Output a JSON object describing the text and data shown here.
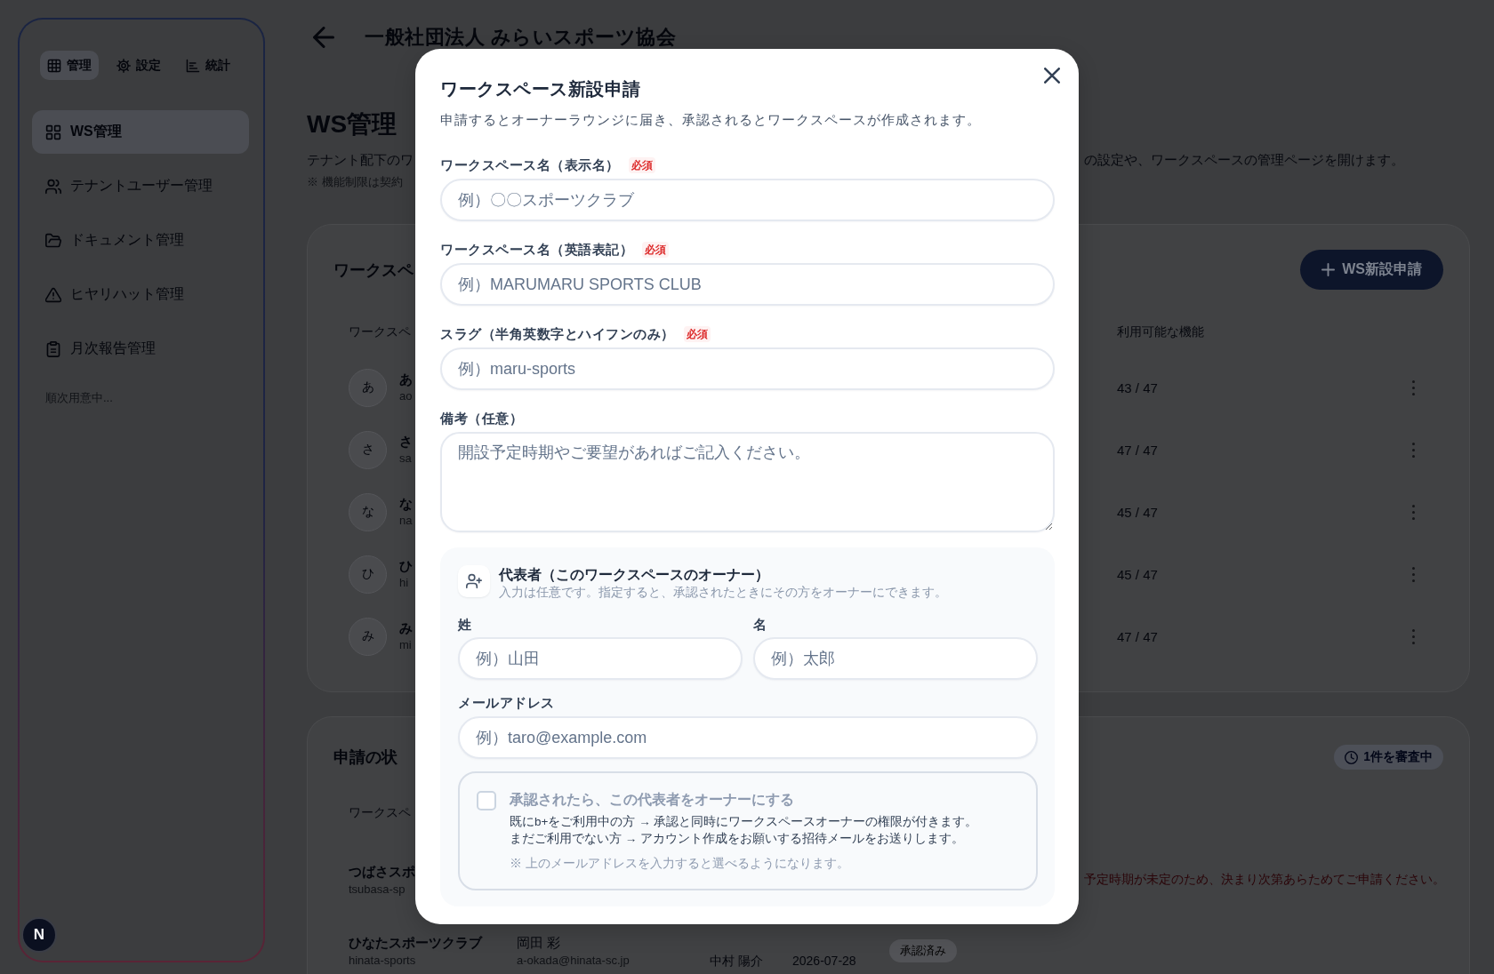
{
  "sidebar": {
    "tabs": [
      {
        "label": "管理",
        "selected": true
      },
      {
        "label": "設定",
        "selected": false
      },
      {
        "label": "統計",
        "selected": false
      }
    ],
    "nav": [
      {
        "label": "WS管理",
        "selected": true
      },
      {
        "label": "テナントユーザー管理",
        "selected": false
      },
      {
        "label": "ドキュメント管理",
        "selected": false
      },
      {
        "label": "ヒヤリハット管理",
        "selected": false
      },
      {
        "label": "月次報告管理",
        "selected": false
      }
    ],
    "note": "順次用意中..."
  },
  "dev_button": {
    "label": "N"
  },
  "header": {
    "title": "一般社団法人 みらいスポーツ協会"
  },
  "page": {
    "heading": "WS管理",
    "description": [
      "テナント配下のワ",
      "の設定や、ワークスペースの管理ページを開けます。"
    ],
    "note": "※ 機能制限は契約"
  },
  "workspaces": {
    "title": "ワークスペ",
    "button": "WS新設申請",
    "columns": [
      "ワークスペ",
      "利用可能な機能"
    ],
    "rows": [
      {
        "initial": "あ",
        "name": "あ",
        "slug": "ao",
        "features": "43 / 47"
      },
      {
        "initial": "さ",
        "name": "さ",
        "slug": "sa",
        "features": "47 / 47"
      },
      {
        "initial": "な",
        "name": "な",
        "slug": "na",
        "features": "45 / 47"
      },
      {
        "initial": "ひ",
        "name": "ひ",
        "slug": "hi",
        "features": "45 / 47"
      },
      {
        "initial": "み",
        "name": "み",
        "slug": "mi",
        "features": "47 / 47"
      }
    ]
  },
  "requests": {
    "title": "申請の状",
    "status": "1件を審査中",
    "columns": [
      "ワークスペ"
    ],
    "rows": [
      {
        "name": "つばさスポ",
        "slug": "tsubasa-sp",
        "note": "予定時期が未定のため、決まり次第あらためてご申請ください。"
      },
      {
        "name": "ひなたスポーツクラブ",
        "slug": "hinata-sports",
        "contact": "岡田 彩",
        "email": "a-okada@hinata-sc.jp",
        "reviewer": "中村 陽介",
        "date": "2026-07-28",
        "status": "承認済み"
      }
    ]
  },
  "dialog": {
    "title": "ワークスペース新設申請",
    "subtitle": "申請するとオーナーラウンジに届き、承認されるとワークスペースが作成されます。",
    "fields": [
      {
        "kind": "input",
        "label": "ワークスペース名（表示名）",
        "tag": "必須",
        "placeholder": "例）〇〇スポーツクラブ"
      },
      {
        "kind": "input",
        "label": "ワークスペース名（英語表記）",
        "tag": "必須",
        "placeholder": "例）MARUMARU SPORTS CLUB"
      },
      {
        "kind": "input",
        "label": "スラグ（半角英数字とハイフンのみ）",
        "tag": "必須",
        "placeholder": "例）maru-sports"
      },
      {
        "kind": "textarea",
        "label": "備考（任意）",
        "placeholder": "開設予定時期やご要望があればご記入ください。"
      }
    ],
    "owner": {
      "title": "代表者（このワークスペースのオーナー）",
      "subtitle": "入力は任意です。指定すると、承認されたときにその方をオーナーにできます。",
      "name_fields": [
        {
          "label": "姓",
          "placeholder": "例）山田"
        },
        {
          "label": "名",
          "placeholder": "例）太郎"
        }
      ],
      "email_field": {
        "label": "メールアドレス",
        "placeholder": "例）taro@example.com"
      },
      "option": {
        "label": "承認されたら、この代表者をオーナーにする",
        "checked": false,
        "disabled": true,
        "lines": [
          "既にb+をご利用中の方 → 承認と同時にワークスペースオーナーの権限が付きます。",
          "まだご利用でない方 → アカウント作成をお願いする招待メールをお送りします。"
        ],
        "hint": "※ 上のメールアドレスを入力すると選べるようになります。"
      }
    }
  }
}
